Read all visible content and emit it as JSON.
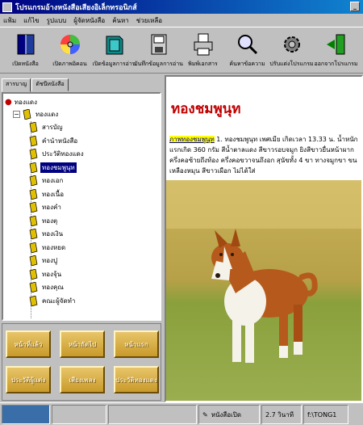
{
  "window": {
    "title": "โปรแกรมอ้างหนังสือเสียงอิเล็กทรอนิกส์"
  },
  "menu": [
    "แฟ้ม",
    "แก้ไข",
    "รูปแบบ",
    "ผู้จัดหนังสือ",
    "ค้นหา",
    "ช่วยเหลือ"
  ],
  "toolbar": [
    {
      "label": "เปิดหนังสือ",
      "icon": "book-icon"
    },
    {
      "label": "เปิดภาพอิคอน",
      "icon": "disc-icon"
    },
    {
      "label": "เปิดข้อมูลการอ่าน",
      "icon": "folder-icon"
    },
    {
      "label": "บันทึกข้อมูลการอ่าน",
      "icon": "save-icon"
    },
    {
      "label": "พิมพ์เอกสาร",
      "icon": "printer-icon"
    },
    {
      "label": "ค้นหาข้อความ",
      "icon": "search-icon"
    },
    {
      "label": "ปรับแต่งโปรแกรม",
      "icon": "settings-icon"
    },
    {
      "label": "ออกจากโปรแกรม",
      "icon": "exit-icon"
    }
  ],
  "tabs": [
    "สารบาญ",
    "ดัชนีหนังสือ"
  ],
  "tree": {
    "root": "ทองแดง",
    "parent": "ทองแดง",
    "items": [
      "สารบัญ",
      "คำนำหนังสือ",
      "ประวัติทองแดง",
      "ทองชมพูนุท",
      "ทองเอก",
      "ทองเนื้อ",
      "ทองคำ",
      "ทองตุ",
      "ทองเงิน",
      "ทองหยด",
      "ทองปู",
      "ทองจุ้น",
      "ทองคุณ",
      "คณะผู้จัดทำ"
    ],
    "selected_index": 3
  },
  "panel_buttons": [
    "หน้าที่แล้ว",
    "หน้าถัดไป",
    "หน้าแรก",
    "ประวัติผู้แต่ง",
    "เสียงเพลง",
    "ประวัติทองแดง"
  ],
  "content": {
    "heading": "ทองชมพูนุท",
    "link": "ภาพทองชมพูนุท",
    "desc": "1. ทองชมพูนุท เพศเมีย เกิดเวลา 13.33 น. น้ำหนักแรกเกิด 360 กรัม สีน้ำตาลแดง สีขาวรอบจมูก ยิงสีขาวยื่นหน้าผาก ครึ่งคอซ้ายถึงท้อง ครึ่งคอขวาจนถึงอก สุนัขทั้ง 4 ขา ทางจมูกขา ขนเหลืองหมุน สีขาวเผือก ไม่ได้ใส่"
  },
  "status": {
    "page": "หนังสือเปิด",
    "time": "2.7 วินาที",
    "file": "f:\\TONG1"
  },
  "colors": {
    "titlebar": "#000080",
    "heading": "#c00000",
    "selected": "#000080",
    "gold": "#d4a93c"
  }
}
